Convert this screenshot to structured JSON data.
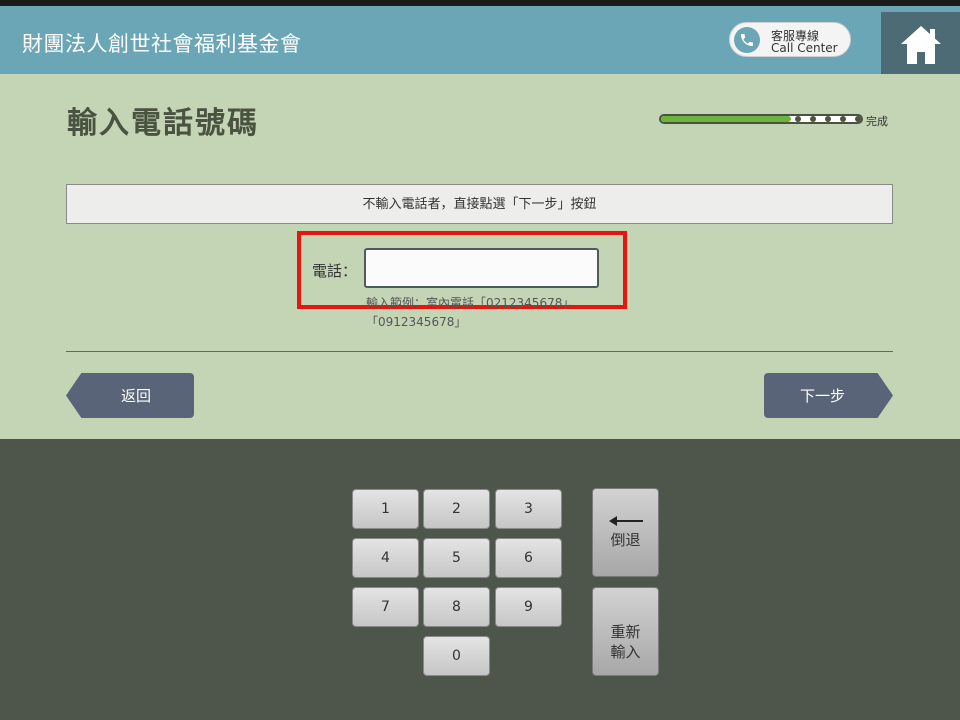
{
  "header": {
    "org_title": "財團法人創世社會福利基金會",
    "call_center_line1": "客服專線",
    "call_center_line2": "Call Center",
    "phone_icon": "phone-icon",
    "home_icon": "home-icon"
  },
  "page": {
    "title": "輸入電話號碼",
    "progress_label": "完成",
    "progress_fraction": 0.65
  },
  "form": {
    "notice": "不輸入電話者，直接點選「下一步」按鈕",
    "phone_label": "電話：",
    "phone_value": "",
    "hint": "輸入範例：室內電話「0212345678」、「0912345678」"
  },
  "nav": {
    "back_label": "返回",
    "next_label": "下一步"
  },
  "keypad": {
    "keys": [
      "1",
      "2",
      "3",
      "4",
      "5",
      "6",
      "7",
      "8",
      "9",
      "0"
    ],
    "backspace_label": "倒退",
    "reset_label": "重新\n輸入",
    "backspace_icon": "left-arrow-icon"
  },
  "colors": {
    "header_bg": "#6aa6b5",
    "main_bg": "#c4d5b6",
    "keypad_bg": "#4e564b",
    "button_bg": "#5a6478",
    "highlight": "#e8150e",
    "progress": "#6cb33f"
  }
}
